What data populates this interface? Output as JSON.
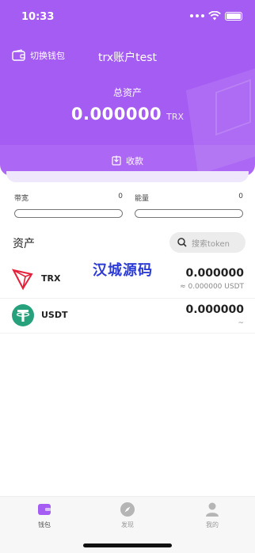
{
  "status": {
    "time": "10:33"
  },
  "header": {
    "switch_wallet": "切换钱包",
    "wallet_title": "trx账户test",
    "total_assets_label": "总资产",
    "total_assets_value": "0.000000",
    "total_assets_unit": "TRX",
    "receive_label": "收款"
  },
  "resources": {
    "bandwidth": {
      "label": "带宽",
      "value": "0",
      "level": 0
    },
    "energy": {
      "label": "能量",
      "value": "0",
      "level": 0
    }
  },
  "assets": {
    "title": "资产",
    "search_placeholder": "搜索token",
    "tokens": [
      {
        "name": "TRX",
        "amount": "0.000000",
        "sub": "≈ 0.000000  USDT",
        "icon": "trx-logo-icon"
      },
      {
        "name": "USDT",
        "amount": "0.000000",
        "sub": "~",
        "icon": "usdt-logo-icon"
      }
    ]
  },
  "watermark": "汉城源码",
  "nav": {
    "wallet": "钱包",
    "discover": "发现",
    "mine": "我的"
  },
  "colors": {
    "brand": "#a55cf3",
    "usdt": "#26a17b",
    "trx": "#e5203a"
  }
}
